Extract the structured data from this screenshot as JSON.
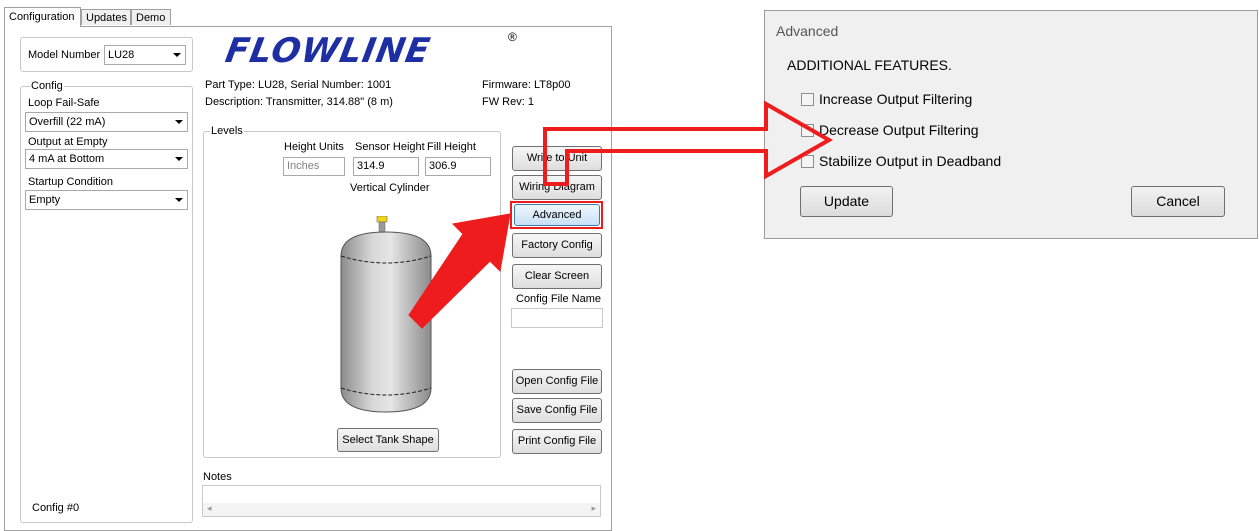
{
  "tabs": [
    {
      "label": "Configuration"
    },
    {
      "label": "Updates"
    },
    {
      "label": "Demo"
    }
  ],
  "model": {
    "label": "Model Number",
    "value": "LU28"
  },
  "logo": {
    "text": "FLOWLINE",
    "reg": "®"
  },
  "info": {
    "part": "Part Type: LU28, Serial Number: 1001",
    "description": "Description: Transmitter, 314.88\" (8 m)",
    "firmware": "Firmware: LT8p00",
    "fwrev": "FW Rev:  1"
  },
  "config": {
    "legend": "Config",
    "loop_label": "Loop Fail-Safe",
    "loop_value": "Overfill (22 mA)",
    "output_label": "Output at Empty",
    "output_value": "4 mA at Bottom",
    "startup_label": "Startup Condition",
    "startup_value": "Empty",
    "config_num": "Config #0"
  },
  "levels": {
    "legend": "Levels",
    "height_units_label": "Height Units",
    "height_units_value": "Inches",
    "sensor_height_label": "Sensor Height",
    "sensor_height_value": "314.9",
    "fill_height_label": "Fill Height",
    "fill_height_value": "306.9",
    "shape_name": "Vertical Cylinder",
    "select_shape_button": "Select Tank Shape"
  },
  "buttons": {
    "write": "Write to Unit",
    "wiring": "Wiring Diagram",
    "advanced": "Advanced",
    "factory": "Factory Config",
    "clear": "Clear Screen",
    "config_file_label": "Config File Name",
    "config_file_value": "",
    "open": "Open Config File",
    "save": "Save Config File",
    "print": "Print Config File"
  },
  "notes": {
    "label": "Notes"
  },
  "dialog": {
    "title": "Advanced",
    "heading": "ADDITIONAL FEATURES.",
    "options": [
      {
        "label": "Increase Output Filtering",
        "checked": false
      },
      {
        "label": "Decrease Output Filtering",
        "checked": false
      },
      {
        "label": "Stabilize Output in Deadband",
        "checked": false
      }
    ],
    "update": "Update",
    "cancel": "Cancel"
  },
  "colors": {
    "annotation": "#ee1c1c",
    "logo": "#1d2fa3"
  }
}
